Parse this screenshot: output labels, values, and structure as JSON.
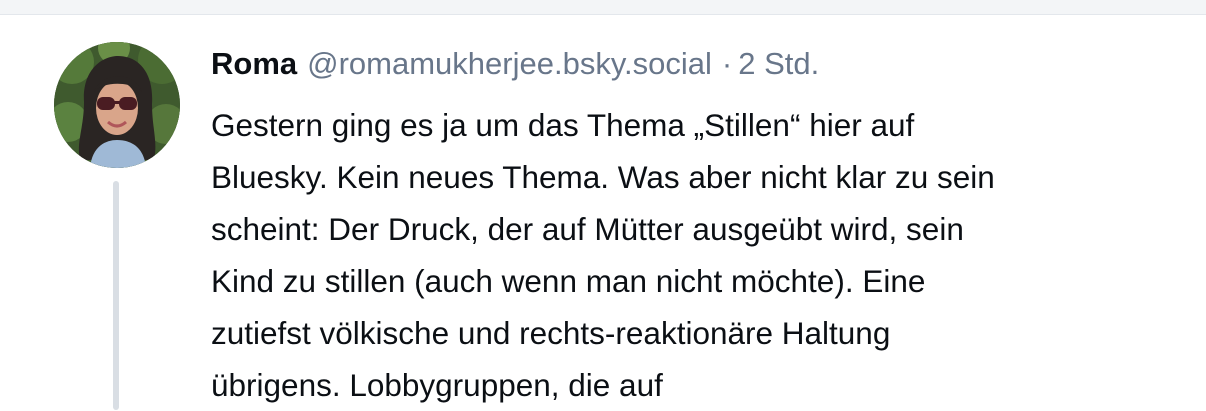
{
  "post": {
    "author_name": "Roma",
    "handle": "@romamukherjee.bsky.social",
    "separator": "·",
    "timestamp": "2 Std.",
    "text_lines": [
      "Gestern ging es ja um das Thema „Stillen“ hier auf",
      "Bluesky. Kein neues Thema. Was aber nicht klar zu sein",
      "scheint: Der Druck, der auf Mütter ausgeübt wird, sein",
      "Kind zu stillen (auch wenn man nicht möchte). Eine",
      "zutiefst völkische und rechts-reaktionäre Haltung",
      "übrigens. Lobbygruppen, die auf"
    ],
    "avatar_icon": "user-avatar-photo"
  },
  "colors": {
    "text": "#0b0f14",
    "muted": "#68768a",
    "thread_line": "#d9dee4",
    "top_strip": "#f3f5f7"
  }
}
